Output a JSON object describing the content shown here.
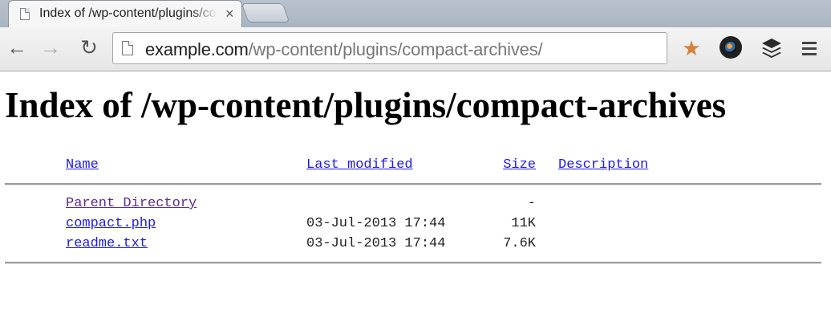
{
  "browser": {
    "tab": {
      "title": "Index of /wp-content/plugins/compact-archives/",
      "close": "×",
      "favicon": "page-icon"
    },
    "new_tab": {
      "icon": "new-tab-icon"
    },
    "nav": {
      "back": "←",
      "forward": "→",
      "reload": "↻"
    },
    "address": {
      "host": "example.com",
      "path": "/wp-content/plugins/compact-archives/",
      "icon": "page-icon"
    },
    "extensions": [
      {
        "name": "star-extension-icon",
        "glyph": "★",
        "color": "#d4813a"
      },
      {
        "name": "camera-extension-icon"
      },
      {
        "name": "layers-extension-icon"
      },
      {
        "name": "menu-icon"
      }
    ]
  },
  "page": {
    "title": "Index of /wp-content/plugins/compact-archives",
    "columns": {
      "name": "Name",
      "modified": "Last modified",
      "size": "Size",
      "description": "Description"
    },
    "rows": [
      {
        "name": "Parent Directory",
        "modified": "",
        "size": "-",
        "description": "",
        "visited": true
      },
      {
        "name": "compact.php",
        "modified": "03-Jul-2013 17:44",
        "size": "11K",
        "description": "",
        "visited": false
      },
      {
        "name": "readme.txt",
        "modified": "03-Jul-2013 17:44",
        "size": "7.6K",
        "description": "",
        "visited": false
      }
    ]
  },
  "colors": {
    "link": "#1d1de0",
    "visited_link": "#5b2d8f",
    "chrome_tabstrip": "#b9c3cf"
  }
}
